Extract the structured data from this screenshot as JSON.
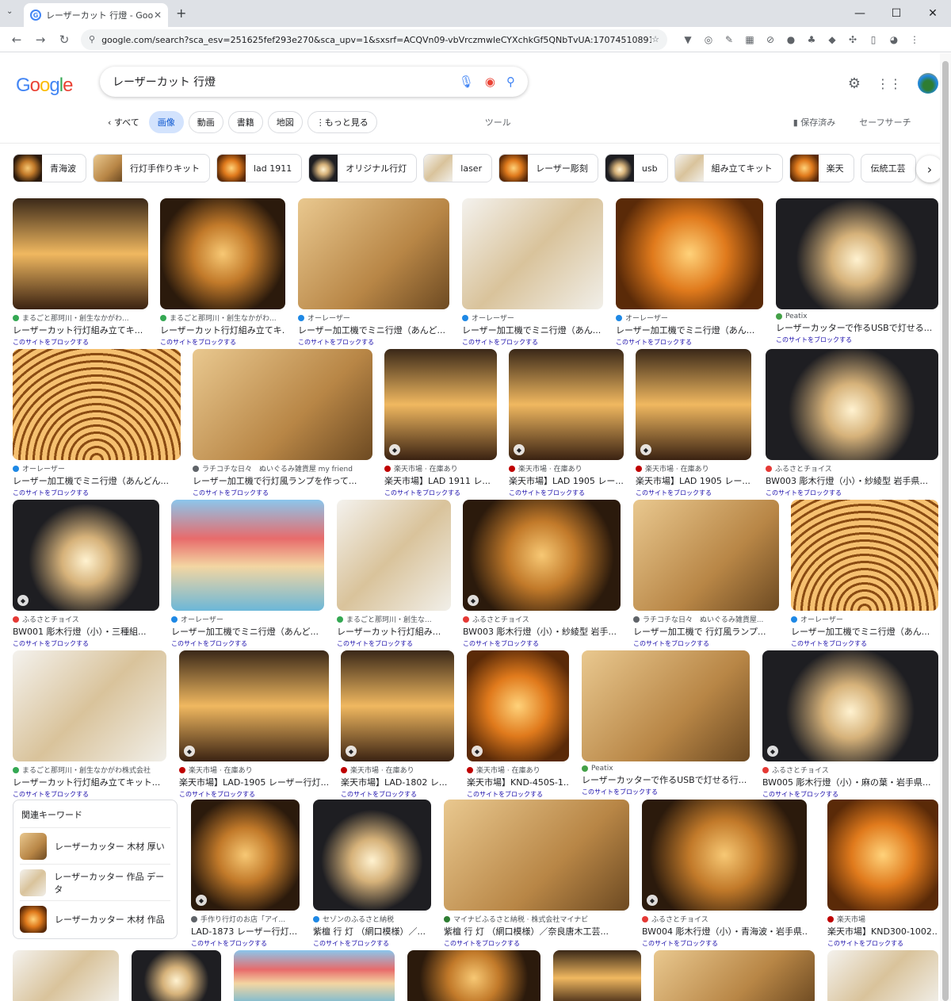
{
  "browser": {
    "tab_title": "レーザーカット 行燈 - Google 検索",
    "url": "google.com/search?sca_esv=251625fef293e270&sca_upv=1&sxsrf=ACQVn09-vbVrczmwleCYXchkGf5QNbTvUA:1707451089108&q=レーザーカ...",
    "new_tab": "+",
    "min": "—",
    "max": "☐",
    "close": "✕"
  },
  "search": {
    "query": "レーザーカット 行燈"
  },
  "filters": {
    "back": "すべて",
    "chips": [
      "画像",
      "動画",
      "書籍",
      "地図",
      "もっと見る"
    ],
    "tools": "ツール",
    "saved": "保存済み",
    "safesearch": "セーフサーチ"
  },
  "related_chips": [
    "青海波",
    "行灯手作りキット",
    "lad 1911",
    "オリジナル行灯",
    "laser",
    "レーザー彫刻",
    "usb",
    "組み立てキット",
    "楽天",
    "伝統工芸"
  ],
  "block_text": "このサイトをブロックする",
  "results": [
    {
      "src": "まるごと那珂川・創生なかがわ...",
      "title": "レーザーカット行灯組み立てキ..."
    },
    {
      "src": "まるごと那珂川・創生なかがわ...",
      "title": "レーザーカット行灯組み立てキ..."
    },
    {
      "src": "オーレーザー",
      "title": "レーザー加工機でミニ行燈（あんど..."
    },
    {
      "src": "オーレーザー",
      "title": "レーザー加工機でミニ行燈（あん..."
    },
    {
      "src": "オーレーザー",
      "title": "レーザー加工機でミニ行燈（あん..."
    },
    {
      "src": "Peatix",
      "title": "レーザーカッターで作るUSBで灯せる..."
    },
    {
      "src": "オーレーザー",
      "title": "レーザー加工機でミニ行燈（あんどん..."
    },
    {
      "src": "ラチコチな日々　ぬいぐるみ雑貨屋 my friend",
      "title": "レーザー加工機で行灯風ランプを作って..."
    },
    {
      "src": "楽天市場 · 在庫あり",
      "title": "楽天市場】LAD 1911 レ..."
    },
    {
      "src": "楽天市場 · 在庫あり",
      "title": "楽天市場】LAD 1905 レー..."
    },
    {
      "src": "楽天市場 · 在庫あり",
      "title": "楽天市場】LAD 1905 レー..."
    },
    {
      "src": "ふるさとチョイス",
      "title": "BW003 彫木行燈（小）・紗綾型 岩手県..."
    },
    {
      "src": "ふるさとチョイス",
      "title": "BW001 彫木行燈（小）・三種組..."
    },
    {
      "src": "オーレーザー",
      "title": "レーザー加工機でミニ行燈（あんど..."
    },
    {
      "src": "まるごと那珂川・創生な...",
      "title": "レーザーカット行灯組み..."
    },
    {
      "src": "ふるさとチョイス",
      "title": "BW003 彫木行燈（小）・紗綾型 岩手..."
    },
    {
      "src": "ラチコチな日々　ぬいぐるみ雑貨屋...",
      "title": "レーザー加工機で 行灯風ランプ..."
    },
    {
      "src": "オーレーザー",
      "title": "レーザー加工機でミニ行燈（あん..."
    },
    {
      "src": "まるごと那珂川・創生なかがわ株式会社",
      "title": "レーザーカット行灯組み立てキット..."
    },
    {
      "src": "楽天市場 · 在庫あり",
      "title": "楽天市場】LAD-1905 レーザー行灯..."
    },
    {
      "src": "楽天市場 · 在庫あり",
      "title": "楽天市場】LAD-1802 レ..."
    },
    {
      "src": "楽天市場 · 在庫あり",
      "title": "楽天市場】KND-450S-1..."
    },
    {
      "src": "Peatix",
      "title": "レーザーカッターで作るUSBで灯せる行..."
    },
    {
      "src": "ふるさとチョイス",
      "title": "BW005 彫木行燈（小）・麻の葉・岩手県..."
    },
    {
      "src": "手作り行灯のお店「アイ...",
      "title": "LAD-1873 レーザー行灯..."
    },
    {
      "src": "セゾンのふるさと納税",
      "title": "紫檀 行 灯 （網口模様）／..."
    },
    {
      "src": "マイナビふるさと納税 · 株式会社マイナビ",
      "title": "紫檀 行 灯 （網口模様）／奈良唐木工芸..."
    },
    {
      "src": "ふるさとチョイス",
      "title": "BW004 彫木行燈（小）・青海波・岩手県..."
    },
    {
      "src": "楽天市場",
      "title": "楽天市場】KND300-1002..."
    }
  ],
  "related_keywords": {
    "heading": "関連キーワード",
    "items": [
      "レーザーカッター 木材 厚い",
      "レーザーカッター 作品 データ",
      "レーザーカッター 木材 作品"
    ]
  },
  "colors": {
    "accent": "#0b57d0",
    "chip_active_bg": "#d3e3fd",
    "link": "#1a0dab"
  }
}
